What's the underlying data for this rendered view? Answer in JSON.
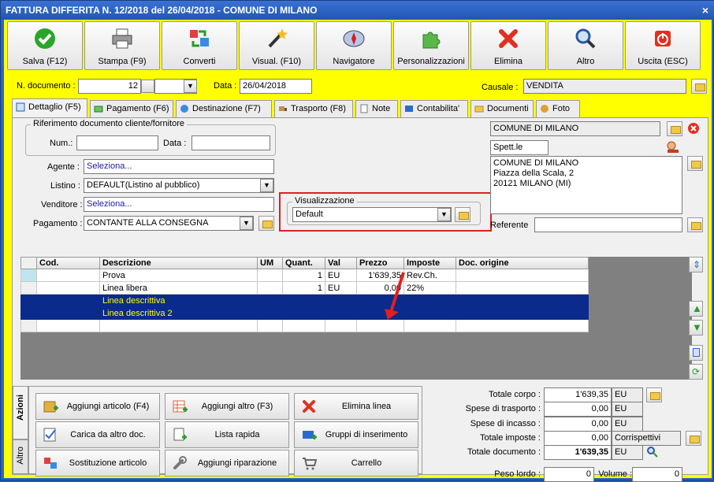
{
  "window": {
    "title": "FATTURA DIFFERITA N. 12/2018 del 26/04/2018 - COMUNE DI MILANO",
    "close": "×"
  },
  "toolbar": [
    {
      "label": "Salva (F12)",
      "icon": "check-icon"
    },
    {
      "label": "Stampa (F9)",
      "icon": "printer-icon"
    },
    {
      "label": "Converti",
      "icon": "convert-icon"
    },
    {
      "label": "Visual. (F10)",
      "icon": "wand-icon"
    },
    {
      "label": "Navigatore",
      "icon": "compass-icon"
    },
    {
      "label": "Personalizzazioni",
      "icon": "puzzle-icon"
    },
    {
      "label": "Elimina",
      "icon": "delete-x-icon"
    },
    {
      "label": "Altro",
      "icon": "magnifier-icon"
    },
    {
      "label": "Uscita (ESC)",
      "icon": "power-icon"
    }
  ],
  "header": {
    "ndoc_label": "N. documento :",
    "ndoc_value": "12",
    "data_label": "Data :",
    "data_value": "26/04/2018",
    "causale_label": "Causale :",
    "causale_value": "VENDITA"
  },
  "tabs": [
    {
      "label": "Dettaglio (F5)"
    },
    {
      "label": "Pagamento (F6)"
    },
    {
      "label": "Destinazione (F7)"
    },
    {
      "label": "Trasporto (F8)"
    },
    {
      "label": "Note"
    },
    {
      "label": "Contabilita'"
    },
    {
      "label": "Documenti"
    },
    {
      "label": "Foto"
    }
  ],
  "rif": {
    "title": "Riferimento documento cliente/fornitore",
    "num_label": "Num.:",
    "data_label": "Data :"
  },
  "fields": {
    "agente_label": "Agente :",
    "agente_value": "Seleziona...",
    "listino_label": "Listino :",
    "listino_value": "DEFAULT(Listino al pubblico)",
    "venditore_label": "Venditore :",
    "venditore_value": "Seleziona...",
    "pagamento_label": "Pagamento :",
    "pagamento_value": "CONTANTE ALLA CONSEGNA"
  },
  "visual": {
    "title": "Visualizzazione",
    "value": "Default"
  },
  "cliente": {
    "name": "COMUNE DI MILANO",
    "spett": "Spett.le",
    "address": [
      "COMUNE DI MILANO",
      "Piazza della Scala, 2",
      "20121 MILANO (MI)"
    ],
    "referente_label": "Referente"
  },
  "grid": {
    "columns": [
      "Cod.",
      "Descrizione",
      "UM",
      "Quant.",
      "Val",
      "Prezzo",
      "Imposte",
      "Doc. origine"
    ],
    "rows": [
      {
        "cod": "",
        "desc": "Prova",
        "um": "",
        "qty": "1",
        "val": "EU",
        "price": "1'639,35",
        "tax": "Rev.Ch.",
        "orig": ""
      },
      {
        "cod": "",
        "desc": "Linea libera",
        "um": "",
        "qty": "1",
        "val": "EU",
        "price": "0,00",
        "tax": "22%",
        "orig": ""
      },
      {
        "cod": "",
        "desc": "Linea descrittiva",
        "um": "",
        "qty": "",
        "val": "",
        "price": "",
        "tax": "",
        "orig": ""
      },
      {
        "cod": "",
        "desc": "Linea descrittiva 2",
        "um": "",
        "qty": "",
        "val": "",
        "price": "",
        "tax": "",
        "orig": ""
      }
    ]
  },
  "side_tabs": {
    "azioni": "Azioni",
    "altro": "Altro"
  },
  "actions": [
    {
      "label": "Aggiungi articolo (F4)",
      "icon": "add-box-icon"
    },
    {
      "label": "Aggiungi altro (F3)",
      "icon": "add-grid-icon"
    },
    {
      "label": "Elimina linea",
      "icon": "delete-x-icon"
    },
    {
      "label": "Carica da altro doc.",
      "icon": "load-doc-icon"
    },
    {
      "label": "Lista rapida",
      "icon": "quick-list-icon"
    },
    {
      "label": "Gruppi di inserimento",
      "icon": "group-insert-icon"
    },
    {
      "label": "Sostituzione articolo",
      "icon": "replace-icon"
    },
    {
      "label": "Aggiungi riparazione",
      "icon": "wrench-icon"
    },
    {
      "label": "Carrello",
      "icon": "cart-icon"
    }
  ],
  "totals": {
    "corpo_label": "Totale corpo :",
    "corpo_value": "1'639,35",
    "corpo_cur": "EU",
    "trasporto_label": "Spese di trasporto :",
    "trasporto_value": "0,00",
    "trasporto_cur": "EU",
    "incasso_label": "Spese di incasso :",
    "incasso_value": "0,00",
    "incasso_cur": "EU",
    "imposte_label": "Totale imposte :",
    "imposte_value": "0,00",
    "imposte_note": "Corrispettivi",
    "documento_label": "Totale documento :",
    "documento_value": "1'639,35",
    "documento_cur": "EU",
    "peso_label": "Peso lordo :",
    "peso_value": "0",
    "volume_label": "Volume :",
    "volume_value": "0"
  },
  "colors": {
    "accent": "#ffff00",
    "title": "#2155b0",
    "selection": "#0a2a8c",
    "highlight": "#e02020"
  }
}
